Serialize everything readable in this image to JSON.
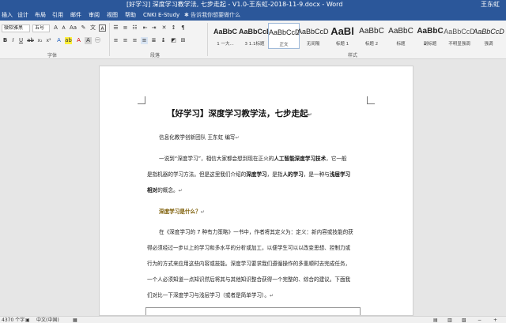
{
  "window": {
    "title": "[好学习] 深度学习教学法, 七步走起 - V1.0-王东虹-2018-11-9.docx - Word",
    "user": "王东虹"
  },
  "tabs": [
    "插入",
    "设计",
    "布局",
    "引用",
    "邮件",
    "审阅",
    "视图",
    "帮助",
    "CNKI E-Study"
  ],
  "search_placeholder": "告诉我你想要做什么",
  "ribbon": {
    "font_name": "微软雅黑",
    "font_size": "五号",
    "font_group_label": "字体",
    "paragraph_group_label": "段落",
    "styles_group_label": "样式",
    "styles": [
      {
        "preview": "AaBbC",
        "name": "1 一大..."
      },
      {
        "preview": "AaBbCcD",
        "name": "3 1.1标题"
      },
      {
        "preview": "AaBbCcDc",
        "name": "正文"
      },
      {
        "preview": "AaBbCcDc",
        "name": "无间隔"
      },
      {
        "preview": "AaBl",
        "name": "标题 1"
      },
      {
        "preview": "AaBbC",
        "name": "标题 2"
      },
      {
        "preview": "AaBbC",
        "name": "标题"
      },
      {
        "preview": "AaBbC",
        "name": "副标题"
      },
      {
        "preview": "AaBbCcD",
        "name": "不明显强调"
      },
      {
        "preview": "AaBbCcD",
        "name": "强调"
      }
    ]
  },
  "document": {
    "title": "【好学习】深度学习教学法，七步走起",
    "author": "信息化教学创新团队  王东虹  编写",
    "para1": {
      "l1a": "一说到“深度学习”，相信大家都会想到现在正火的",
      "l1b": "人工智能深度学习技术",
      "l1c": "，它一般",
      "l2a": "是指机器的学习方法。但是这里我们介绍的",
      "l2b": "深度学习",
      "l2c": "，是指",
      "l2d": "人的学习",
      "l2e": "，是一种与",
      "l2f": "浅层学习",
      "l3a": "相对",
      "l3b": "的概念。"
    },
    "question": "深度学习是什么？",
    "para2": [
      "在《深度学习的 7 种有力策略》一书中，作者将其定义为：定义：新内容或技能的获",
      "得必须经过一步以上的学习和多水平的分析或加工，以便学生可以以改变思想、控制力或",
      "行为的方式来应用这些内容或技能。深度学习要求我们遵循操作的多重顺时去完成任务，",
      "一个人必须知道一点知识然后将其与其他知识整合获得一个完整的、综合的建议。下面我",
      "们对比一下深度学习与浅层学习（或者是简单学习）。"
    ]
  },
  "status": {
    "words": "4370 个字",
    "language": "中文(中国)"
  }
}
